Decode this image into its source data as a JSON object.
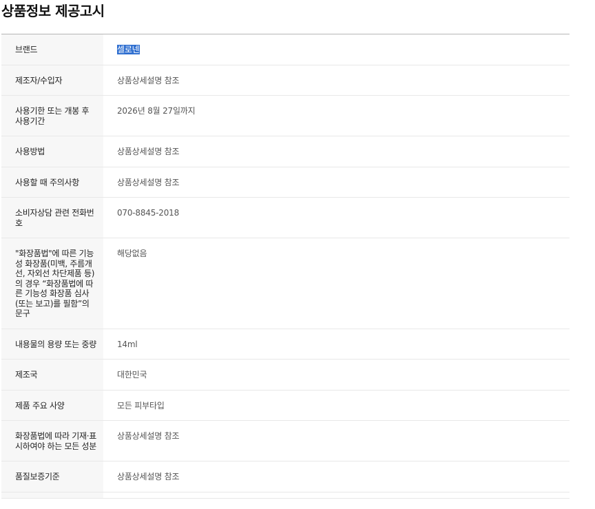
{
  "page": {
    "title": "상품정보 제공고시"
  },
  "rows": [
    {
      "label": "브랜드",
      "value": "셀로넨"
    },
    {
      "label": "제조자/수입자",
      "value": "상품상세설명 참조"
    },
    {
      "label": "사용기한 또는 개봉 후 사용기간",
      "value": "2026년 8월 27일까지"
    },
    {
      "label": "사용방법",
      "value": "상품상세설명 참조"
    },
    {
      "label": "사용할 때 주의사항",
      "value": "상품상세설명 참조"
    },
    {
      "label": "소비자상담 관련 전화번호",
      "value": "070-8845-2018"
    },
    {
      "label": "\"화장품법\"에 따른 기능성 화장품(미백, 주름개선, 자외선 차단제품 등)의 경우 “화장품법에 따른 기능성 화장품 심사(또는 보고)를 필함”의 문구",
      "value": "해당없음"
    },
    {
      "label": "내용물의 용량 또는 중량",
      "value": "14ml"
    },
    {
      "label": "제조국",
      "value": "대한민국"
    },
    {
      "label": "제품 주요 사양",
      "value": "모든 피부타입"
    },
    {
      "label": "화장품법에 따라 기재·표시하여야 하는 모든 성분",
      "value": "상품상세설명 참조"
    },
    {
      "label": "품질보증기준",
      "value": "상품상세설명 참조"
    }
  ]
}
